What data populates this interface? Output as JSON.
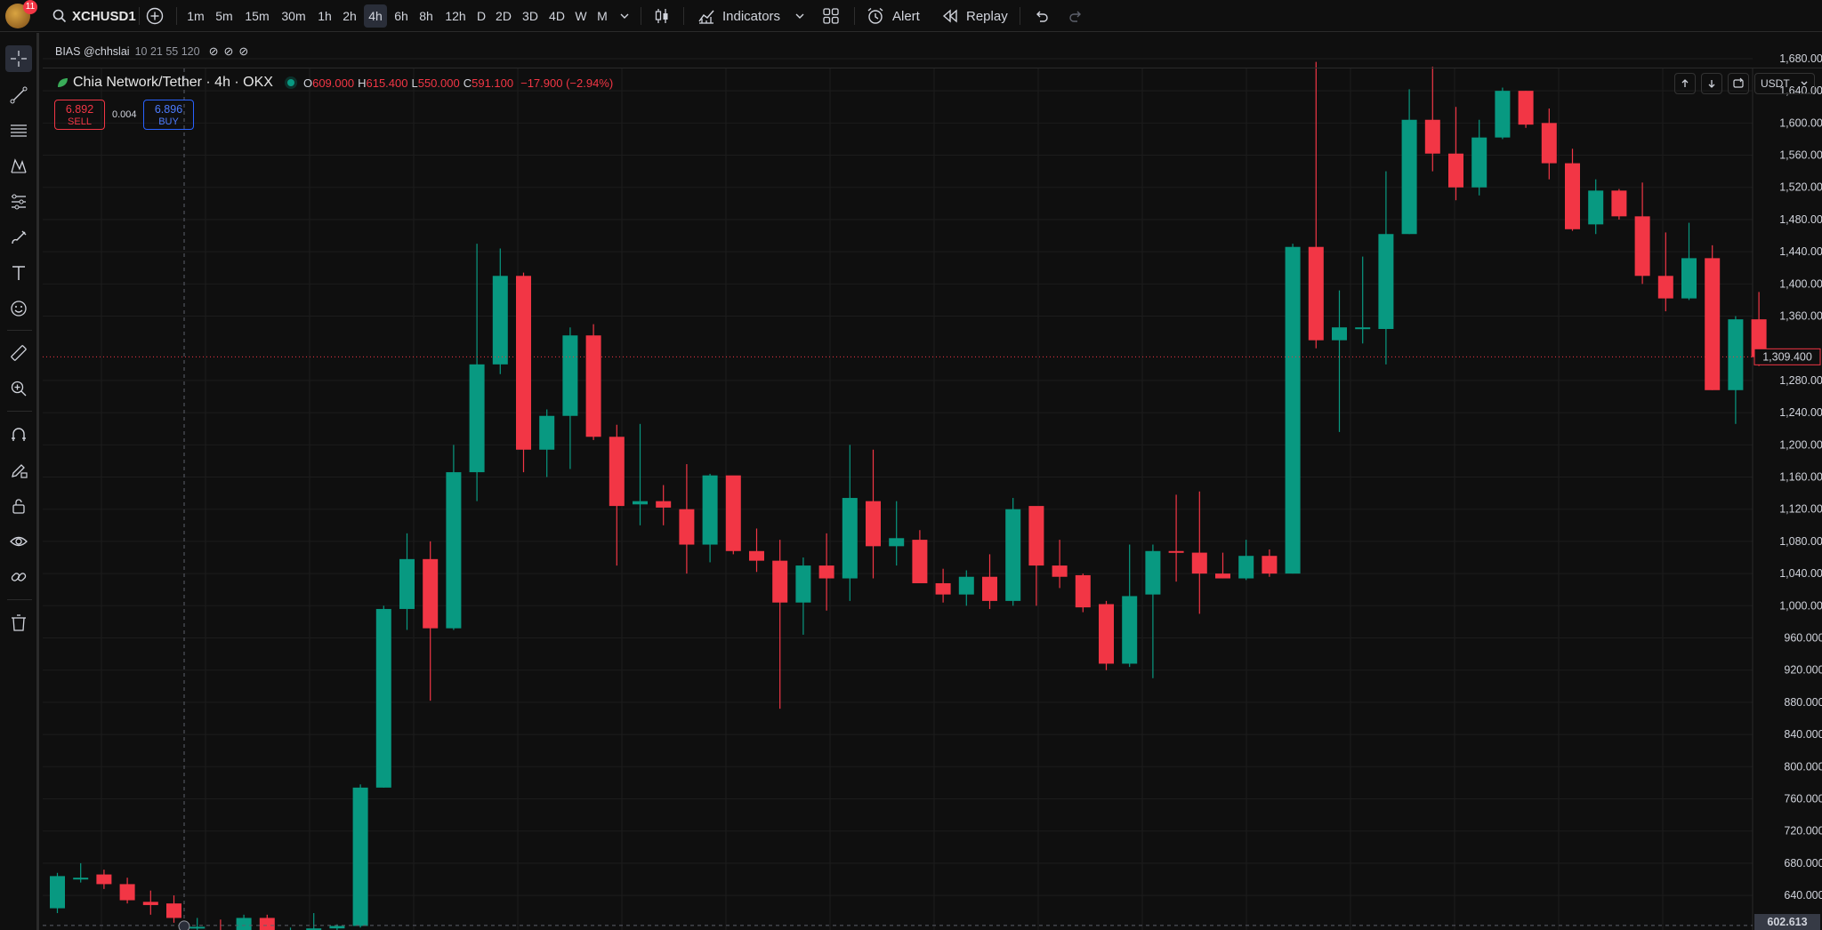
{
  "topbar": {
    "notifications": "11",
    "symbol": "XCHUSD1",
    "intervals": [
      "1m",
      "5m",
      "15m",
      "30m",
      "1h",
      "2h",
      "4h",
      "6h",
      "8h",
      "12h",
      "D",
      "2D",
      "3D",
      "4D",
      "W",
      "M"
    ],
    "active_interval": "4h",
    "indicators_label": "Indicators",
    "alert_label": "Alert",
    "replay_label": "Replay"
  },
  "indicator": {
    "name": "BIAS @chhslai",
    "params": "10 21 55 120"
  },
  "legend": {
    "title": "Chia Network/Tether · 4h · OKX",
    "o_label": "O",
    "o": "609.000",
    "h_label": "H",
    "h": "615.400",
    "l_label": "L",
    "l": "550.000",
    "c_label": "C",
    "c": "591.100",
    "change": "−17.900 (−2.94%)"
  },
  "trade": {
    "sell_price": "6.892",
    "sell_label": "SELL",
    "spread": "0.004",
    "buy_price": "6.896",
    "buy_label": "BUY"
  },
  "currency": "USDT",
  "colors": {
    "up": "#089981",
    "down": "#f23645",
    "bg": "#0f0f0f",
    "grid": "#1c1c1c",
    "text": "#d1d4dc"
  },
  "chart_data": {
    "type": "candlestick",
    "symbol": "XCHUSD1",
    "price_ticks": [
      "1,680.000",
      "1,640.000",
      "1,600.000",
      "1,560.000",
      "1,520.000",
      "1,480.000",
      "1,440.000",
      "1,400.000",
      "1,360.000",
      "1,280.000",
      "1,240.000",
      "1,200.000",
      "1,160.000",
      "1,120.000",
      "1,080.000",
      "1,040.000",
      "1,000.000",
      "960.000",
      "920.000",
      "880.000",
      "840.000",
      "800.000",
      "760.000",
      "720.000",
      "680.000",
      "640.000"
    ],
    "last_price": "1,309.400",
    "crosshair_price": "602.613",
    "ylim": [
      597,
      1712
    ],
    "candles": [
      {
        "o": 624,
        "h": 668,
        "l": 618,
        "c": 664
      },
      {
        "o": 662,
        "h": 680,
        "l": 656,
        "c": 662
      },
      {
        "o": 666,
        "h": 672,
        "l": 648,
        "c": 654
      },
      {
        "o": 654,
        "h": 662,
        "l": 630,
        "c": 634
      },
      {
        "o": 632,
        "h": 646,
        "l": 616,
        "c": 628
      },
      {
        "o": 630,
        "h": 640,
        "l": 606,
        "c": 612
      },
      {
        "o": 600,
        "h": 612,
        "l": 590,
        "c": 601
      },
      {
        "o": 592,
        "h": 610,
        "l": 584,
        "c": 588
      },
      {
        "o": 594,
        "h": 616,
        "l": 590,
        "c": 612
      },
      {
        "o": 612,
        "h": 616,
        "l": 586,
        "c": 592
      },
      {
        "o": 594,
        "h": 600,
        "l": 588,
        "c": 597
      },
      {
        "o": 597,
        "h": 618,
        "l": 590,
        "c": 599
      },
      {
        "o": 599,
        "h": 604,
        "l": 594,
        "c": 602
      },
      {
        "o": 602,
        "h": 778,
        "l": 600,
        "c": 774
      },
      {
        "o": 774,
        "h": 1000,
        "l": 774,
        "c": 996
      },
      {
        "o": 996,
        "h": 1090,
        "l": 970,
        "c": 1058
      },
      {
        "o": 1058,
        "h": 1080,
        "l": 882,
        "c": 972
      },
      {
        "o": 972,
        "h": 1200,
        "l": 970,
        "c": 1166
      },
      {
        "o": 1166,
        "h": 1450,
        "l": 1130,
        "c": 1300
      },
      {
        "o": 1300,
        "h": 1444,
        "l": 1288,
        "c": 1410
      },
      {
        "o": 1410,
        "h": 1414,
        "l": 1166,
        "c": 1194
      },
      {
        "o": 1194,
        "h": 1244,
        "l": 1160,
        "c": 1236
      },
      {
        "o": 1236,
        "h": 1346,
        "l": 1170,
        "c": 1336
      },
      {
        "o": 1336,
        "h": 1350,
        "l": 1206,
        "c": 1210
      },
      {
        "o": 1210,
        "h": 1225,
        "l": 1050,
        "c": 1124
      },
      {
        "o": 1126,
        "h": 1226,
        "l": 1100,
        "c": 1130
      },
      {
        "o": 1130,
        "h": 1150,
        "l": 1100,
        "c": 1122
      },
      {
        "o": 1120,
        "h": 1176,
        "l": 1040,
        "c": 1076
      },
      {
        "o": 1076,
        "h": 1164,
        "l": 1054,
        "c": 1162
      },
      {
        "o": 1162,
        "h": 1160,
        "l": 1064,
        "c": 1068
      },
      {
        "o": 1068,
        "h": 1096,
        "l": 1042,
        "c": 1056
      },
      {
        "o": 1056,
        "h": 1082,
        "l": 872,
        "c": 1004
      },
      {
        "o": 1004,
        "h": 1060,
        "l": 964,
        "c": 1050
      },
      {
        "o": 1050,
        "h": 1090,
        "l": 994,
        "c": 1034
      },
      {
        "o": 1034,
        "h": 1200,
        "l": 1006,
        "c": 1134
      },
      {
        "o": 1130,
        "h": 1194,
        "l": 1034,
        "c": 1074
      },
      {
        "o": 1074,
        "h": 1130,
        "l": 1050,
        "c": 1084
      },
      {
        "o": 1082,
        "h": 1094,
        "l": 1032,
        "c": 1028
      },
      {
        "o": 1028,
        "h": 1046,
        "l": 1004,
        "c": 1014
      },
      {
        "o": 1014,
        "h": 1044,
        "l": 1000,
        "c": 1036
      },
      {
        "o": 1036,
        "h": 1064,
        "l": 996,
        "c": 1006
      },
      {
        "o": 1006,
        "h": 1134,
        "l": 1000,
        "c": 1120
      },
      {
        "o": 1124,
        "h": 1122,
        "l": 1000,
        "c": 1050
      },
      {
        "o": 1050,
        "h": 1082,
        "l": 1022,
        "c": 1036
      },
      {
        "o": 1038,
        "h": 1040,
        "l": 992,
        "c": 998
      },
      {
        "o": 1002,
        "h": 1006,
        "l": 920,
        "c": 928
      },
      {
        "o": 928,
        "h": 1076,
        "l": 924,
        "c": 1012
      },
      {
        "o": 1014,
        "h": 1076,
        "l": 910,
        "c": 1068
      },
      {
        "o": 1068,
        "h": 1138,
        "l": 1030,
        "c": 1066
      },
      {
        "o": 1066,
        "h": 1142,
        "l": 990,
        "c": 1040
      },
      {
        "o": 1040,
        "h": 1066,
        "l": 1034,
        "c": 1034
      },
      {
        "o": 1034,
        "h": 1082,
        "l": 1032,
        "c": 1062
      },
      {
        "o": 1062,
        "h": 1070,
        "l": 1036,
        "c": 1040
      },
      {
        "o": 1040,
        "h": 1450,
        "l": 1040,
        "c": 1446
      },
      {
        "o": 1446,
        "h": 1676,
        "l": 1320,
        "c": 1330
      },
      {
        "o": 1330,
        "h": 1392,
        "l": 1216,
        "c": 1346
      },
      {
        "o": 1346,
        "h": 1434,
        "l": 1326,
        "c": 1346
      },
      {
        "o": 1344,
        "h": 1540,
        "l": 1300,
        "c": 1462
      },
      {
        "o": 1462,
        "h": 1642,
        "l": 1462,
        "c": 1604
      },
      {
        "o": 1604,
        "h": 1670,
        "l": 1540,
        "c": 1562
      },
      {
        "o": 1562,
        "h": 1620,
        "l": 1504,
        "c": 1520
      },
      {
        "o": 1520,
        "h": 1604,
        "l": 1510,
        "c": 1582
      },
      {
        "o": 1582,
        "h": 1644,
        "l": 1580,
        "c": 1640
      },
      {
        "o": 1640,
        "h": 1640,
        "l": 1594,
        "c": 1598
      },
      {
        "o": 1600,
        "h": 1618,
        "l": 1530,
        "c": 1550
      },
      {
        "o": 1550,
        "h": 1568,
        "l": 1466,
        "c": 1468
      },
      {
        "o": 1474,
        "h": 1530,
        "l": 1462,
        "c": 1516
      },
      {
        "o": 1516,
        "h": 1518,
        "l": 1480,
        "c": 1484
      },
      {
        "o": 1484,
        "h": 1526,
        "l": 1400,
        "c": 1410
      },
      {
        "o": 1410,
        "h": 1464,
        "l": 1366,
        "c": 1382
      },
      {
        "o": 1382,
        "h": 1476,
        "l": 1380,
        "c": 1432
      },
      {
        "o": 1432,
        "h": 1448,
        "l": 1268,
        "c": 1268
      },
      {
        "o": 1268,
        "h": 1360,
        "l": 1226,
        "c": 1356
      },
      {
        "o": 1356,
        "h": 1390,
        "l": 1298,
        "c": 1309
      }
    ]
  }
}
